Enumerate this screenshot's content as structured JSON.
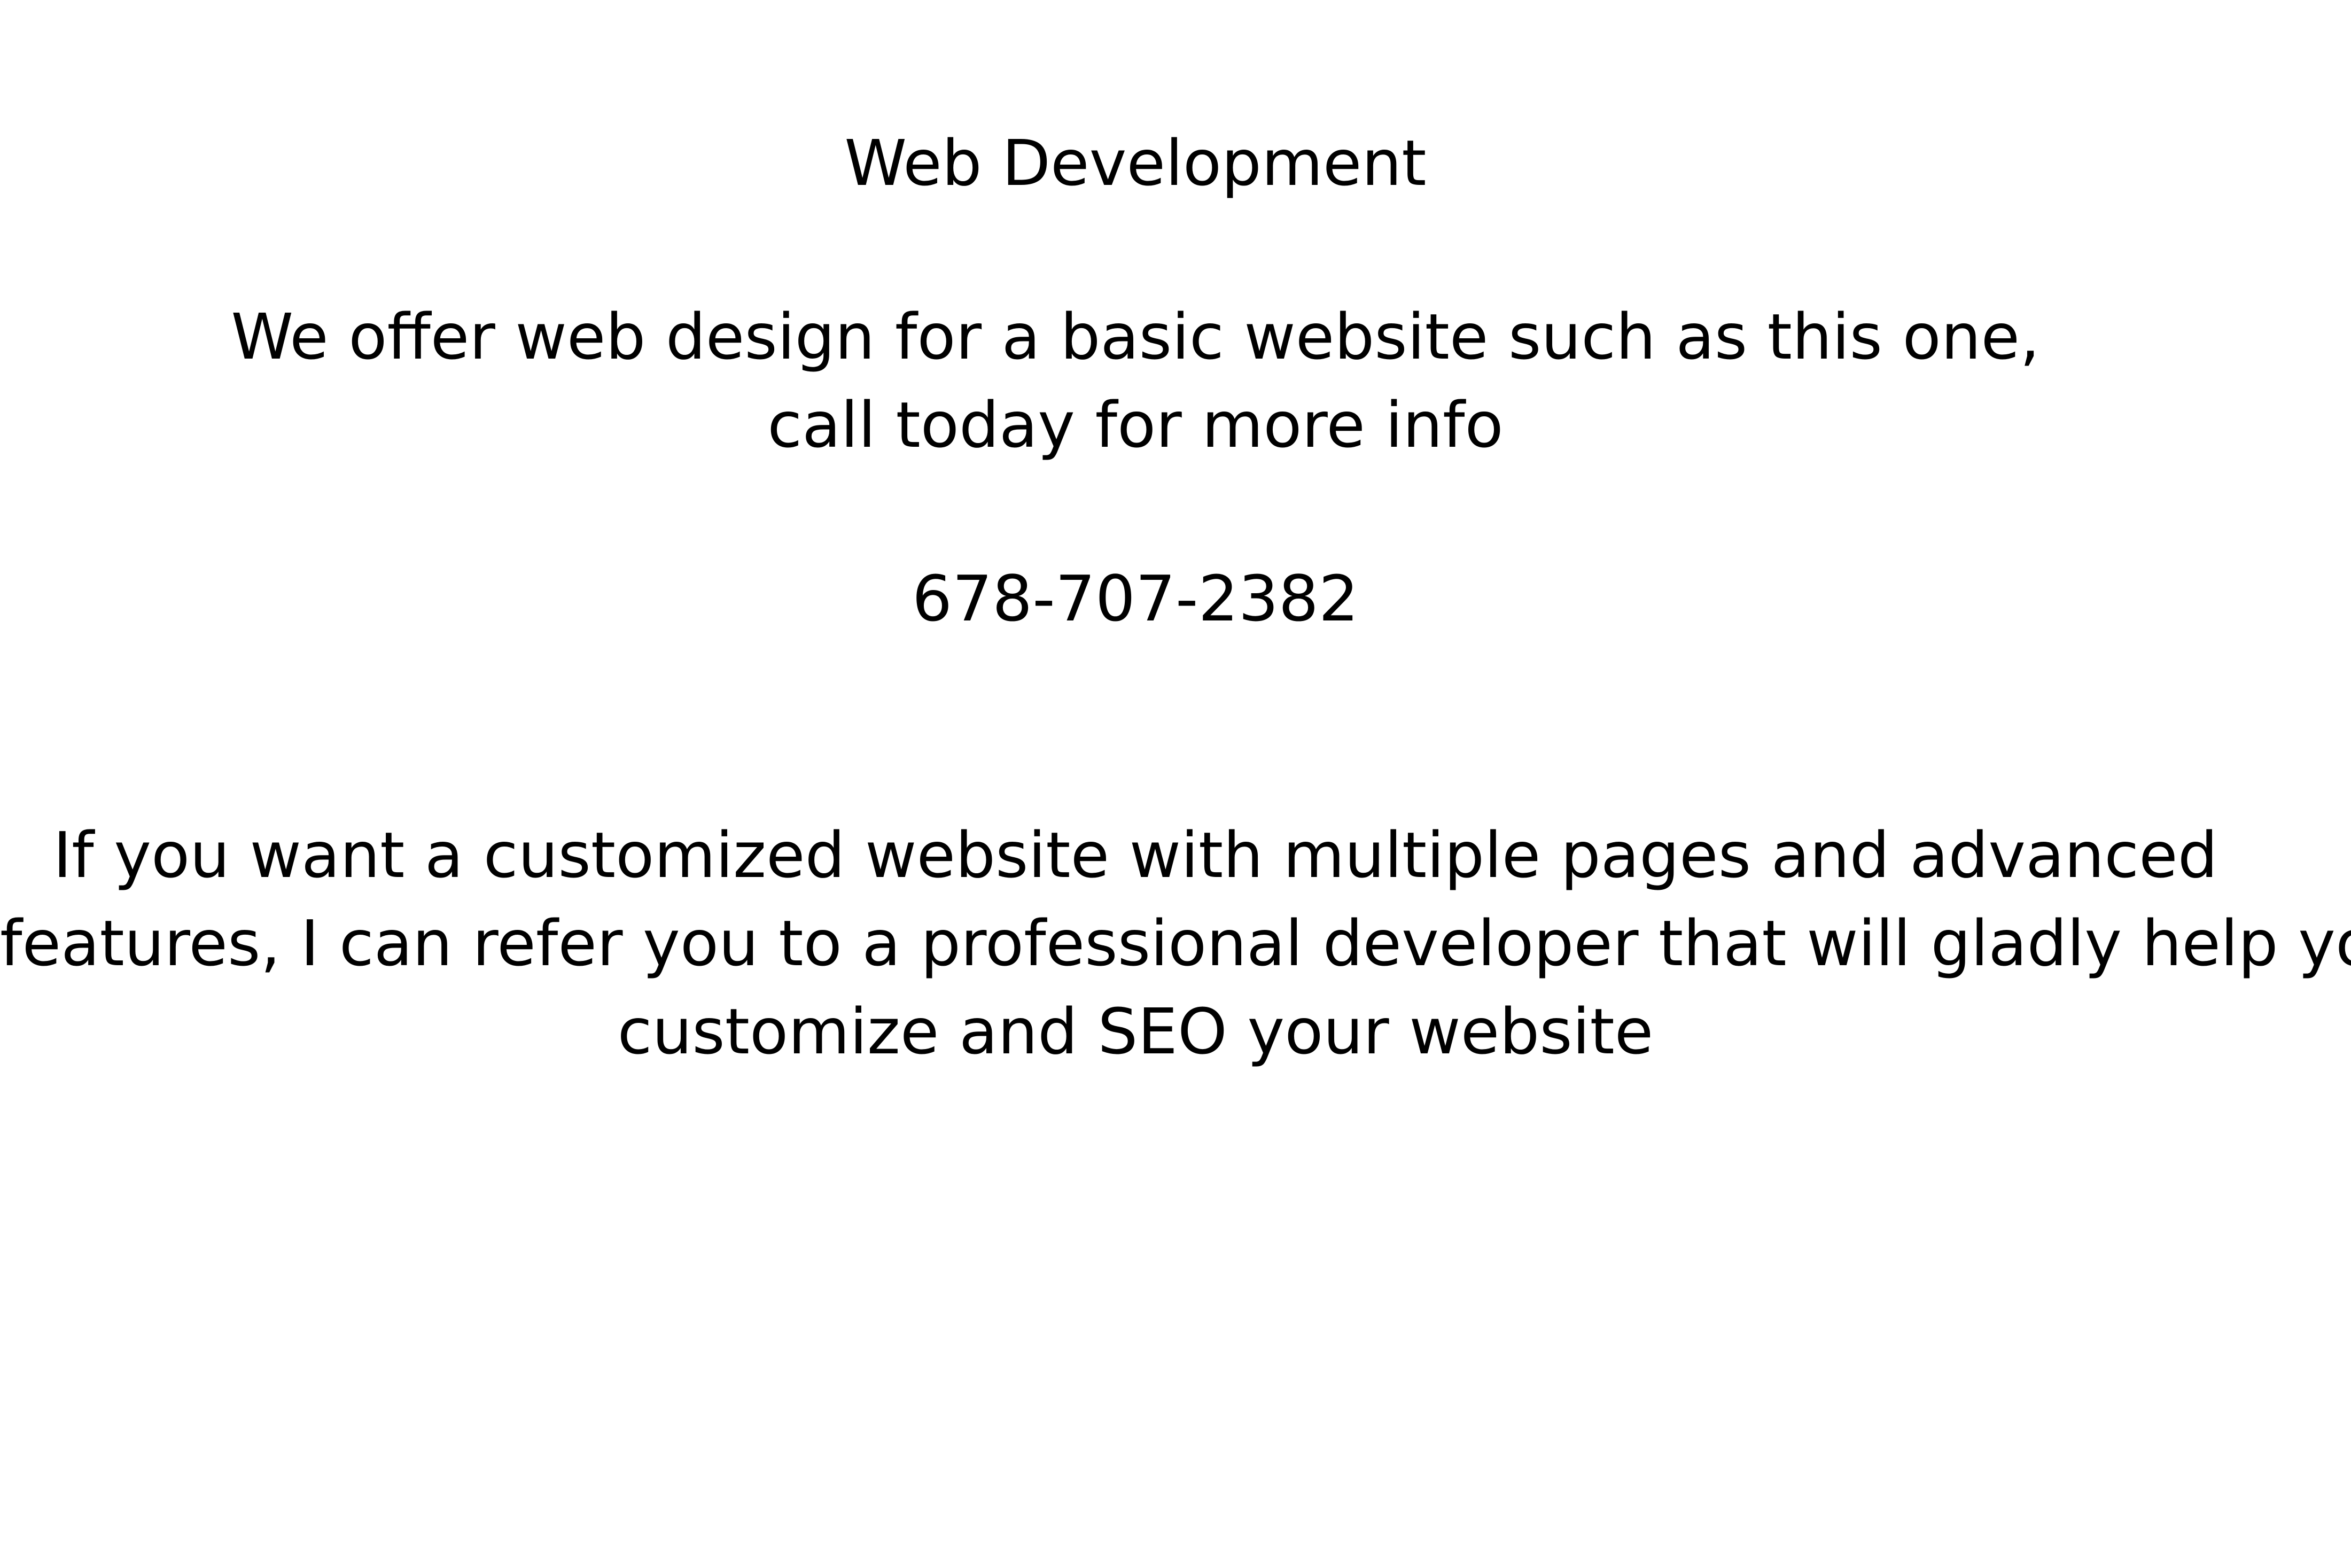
{
  "title": "Web Development",
  "offer": {
    "line1": "We offer web design for a basic website such as this one,",
    "line2": "call today for more info"
  },
  "phone": "678-707-2382",
  "custom": {
    "line1": "If you want a customized website with multiple pages and advanced",
    "line2": "features, I can refer you to a professional developer that will gladly help you",
    "line3": "customize and SEO your website"
  }
}
